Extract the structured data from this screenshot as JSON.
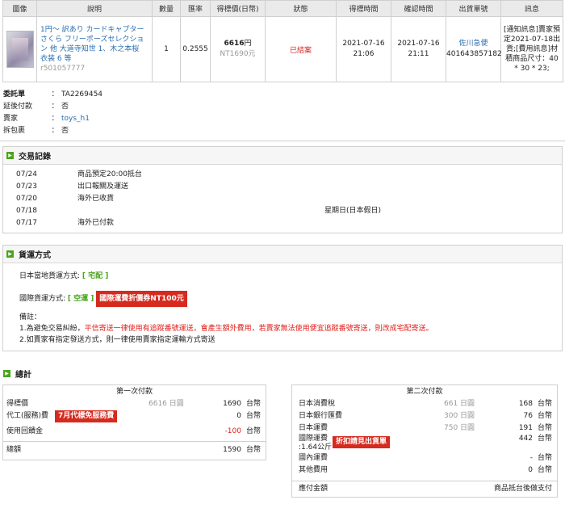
{
  "order_table": {
    "headers": [
      "圖像",
      "說明",
      "數量",
      "匯率",
      "得標價(日幣)",
      "狀態",
      "得標時間",
      "確認時間",
      "出貨單號",
      "訊息"
    ],
    "row": {
      "title": "1円～ 訳あり カードキャプターさくら フリーポーズセレクション 他 大道寺知世 1、木之本桜 衣装 6 等",
      "item_id": "r501057777",
      "quantity": "1",
      "rate": "0.2555",
      "price_jpy": "6616",
      "price_jpy_unit": "円",
      "price_twd": "NT1690元",
      "status": "已結案",
      "won_date": "2021-07-16",
      "won_time": "21:06",
      "confirm_date": "2021-07-16",
      "confirm_time": "21:11",
      "carrier": "佐川急便",
      "tracking": "401643857182",
      "message": "[通知訊息]賣家預定2021-07-18出貨;[費用訊息]材積商品尺寸：40 * 30 * 23;"
    }
  },
  "info": {
    "order_label": "委託單",
    "order_value": "TA2269454",
    "deferred_label": "延後付款",
    "deferred_value": "否",
    "seller_label": "賣家",
    "seller_value": "toys_h1",
    "unpack_label": "拆包裹",
    "unpack_value": "否",
    "colon": "："
  },
  "records": {
    "title": "交易記錄",
    "items": [
      {
        "date": "07/24",
        "event": "商品預定20:00抵台",
        "note": ""
      },
      {
        "date": "07/23",
        "event": "出口報關及運送",
        "note": ""
      },
      {
        "date": "07/20",
        "event": "海外已收貨",
        "note": ""
      },
      {
        "date": "07/18",
        "event": "",
        "note": "星期日(日本假日)"
      },
      {
        "date": "07/17",
        "event": "海外已付款",
        "note": ""
      }
    ]
  },
  "shipping": {
    "title": "貨運方式",
    "domestic_label": "日本當地貨運方式:",
    "domestic_value": "[ 宅配 ]",
    "intl_label": "國際貨運方式:",
    "intl_value": "[ 空運 ]",
    "intl_badge": "國際運費折價券NT100元",
    "remarks_label": "備註：",
    "remark1_a": "1.為避免交易糾紛，",
    "remark1_b": "平信寄送一律使用有追蹤番號運送，會產生額外費用，若賣家無法使用便宜追蹤番號寄送，則改成宅配寄送。",
    "remark2": "2.如賣家有指定發送方式，則一律使用賣家指定運輸方式寄送"
  },
  "totals": {
    "title": "總計",
    "first": {
      "title": "第一次付款",
      "rows": [
        {
          "label": "得標價",
          "jpy": "6616 日圓",
          "twd": "1690",
          "unit": "台幣",
          "badge": ""
        },
        {
          "label": "代工(服務)費",
          "jpy": "",
          "twd": "0",
          "unit": "台幣",
          "badge": "7月代標免服務費"
        },
        {
          "label": "使用回饋金",
          "jpy": "",
          "twd": "-100",
          "unit": "台幣",
          "badge": ""
        }
      ],
      "total_label": "總額",
      "total_value": "1590",
      "total_unit": "台幣"
    },
    "second": {
      "title": "第二次付款",
      "rows": [
        {
          "label": "日本消費稅",
          "jpy": "661 日圓",
          "twd": "168",
          "unit": "台幣"
        },
        {
          "label": "日本銀行匯費",
          "jpy": "300 日圓",
          "twd": "76",
          "unit": "台幣"
        },
        {
          "label": "日本運費",
          "jpy": "750 日圓",
          "twd": "191",
          "unit": "台幣"
        }
      ],
      "intl_label": "國際運費",
      "intl_weight": ":1.64公斤",
      "intl_badge": "折扣請見出貨單",
      "intl_value": "442",
      "intl_unit": "台幣",
      "domestic_label": "國內運費",
      "domestic_value": "-",
      "domestic_unit": "台幣",
      "other_label": "其他費用",
      "other_value": "0",
      "other_unit": "台幣",
      "payable_label": "應付金額",
      "payable_value": "商品抵台後做支付"
    }
  },
  "colors": {
    "accent_green": "#4aa51d",
    "alert_red": "#e0201b",
    "link_blue": "#2a6db0"
  }
}
